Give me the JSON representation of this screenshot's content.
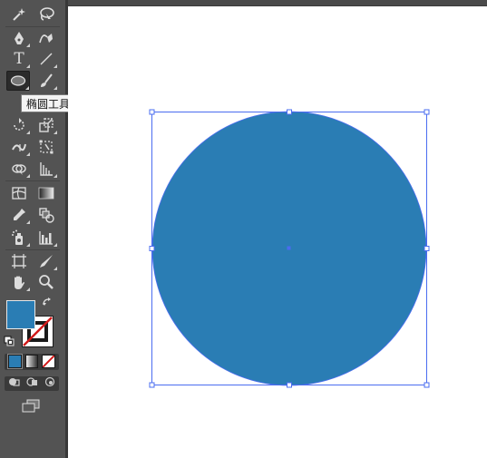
{
  "tooltip": {
    "text": "椭圆工具 (L)"
  },
  "colors": {
    "fill": "#2a7db4",
    "selection": "#4a6cf0",
    "toolbar_bg": "#535353",
    "active_tool_bg": "#2b2b2b",
    "none_slash": "#d21a1a"
  },
  "tools": [
    {
      "name": "magic-wand-icon",
      "row": 0,
      "col": 0
    },
    {
      "name": "lasso-icon",
      "row": 0,
      "col": 1
    },
    {
      "name": "pen-icon",
      "row": 1,
      "col": 0
    },
    {
      "name": "curvature-icon",
      "row": 1,
      "col": 1
    },
    {
      "name": "type-icon",
      "row": 2,
      "col": 0,
      "glyph": "T"
    },
    {
      "name": "line-segment-icon",
      "row": 2,
      "col": 1
    },
    {
      "name": "ellipse-icon",
      "row": 3,
      "col": 0,
      "active": true
    },
    {
      "name": "paintbrush-icon",
      "row": 3,
      "col": 1
    },
    {
      "name": "rotate-icon",
      "row": 5,
      "col": 0
    },
    {
      "name": "scale-icon",
      "row": 5,
      "col": 1
    },
    {
      "name": "width-icon",
      "row": 6,
      "col": 0
    },
    {
      "name": "free-transform-icon",
      "row": 6,
      "col": 1
    },
    {
      "name": "shape-builder-icon",
      "row": 7,
      "col": 0
    },
    {
      "name": "perspective-grid-icon",
      "row": 7,
      "col": 1
    },
    {
      "name": "mesh-icon",
      "row": 8,
      "col": 0
    },
    {
      "name": "gradient-icon",
      "row": 8,
      "col": 1
    },
    {
      "name": "eyedropper-icon",
      "row": 9,
      "col": 0
    },
    {
      "name": "blend-icon",
      "row": 9,
      "col": 1
    },
    {
      "name": "symbol-sprayer-icon",
      "row": 10,
      "col": 0
    },
    {
      "name": "column-graph-icon",
      "row": 10,
      "col": 1
    },
    {
      "name": "artboard-icon",
      "row": 11,
      "col": 0
    },
    {
      "name": "slice-icon",
      "row": 11,
      "col": 1
    },
    {
      "name": "hand-icon",
      "row": 12,
      "col": 0
    },
    {
      "name": "zoom-icon",
      "row": 12,
      "col": 1
    }
  ]
}
